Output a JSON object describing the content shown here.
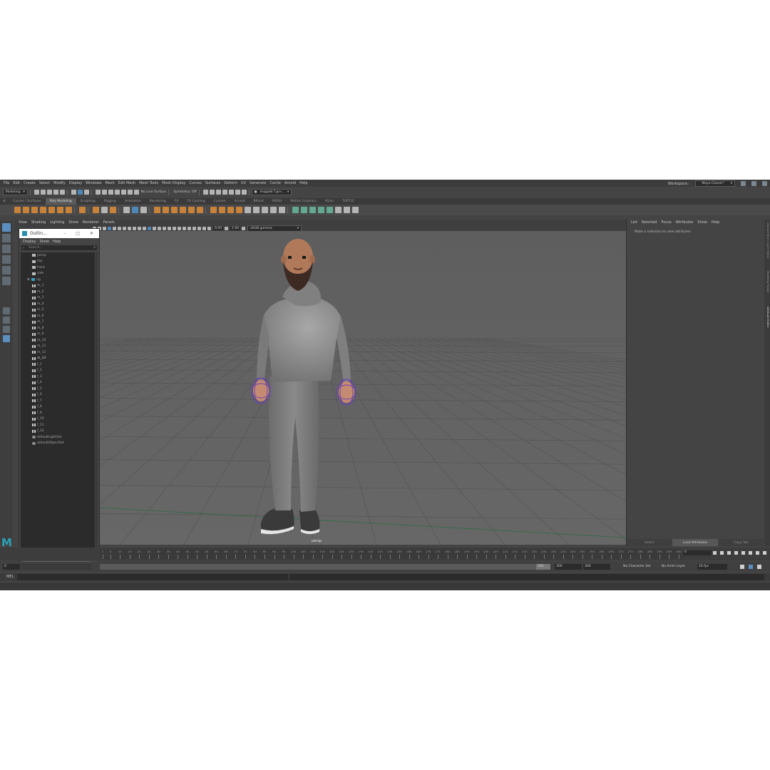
{
  "menubar": {
    "items": [
      "File",
      "Edit",
      "Create",
      "Select",
      "Modify",
      "Display",
      "Windows",
      "Mesh",
      "Edit Mesh",
      "Mesh Tools",
      "Mesh Display",
      "Curves",
      "Surfaces",
      "Deform",
      "UV",
      "Generate",
      "Cache",
      "Arnold",
      "Help"
    ],
    "workspace_label": "Workspace :",
    "workspace_value": "Maya Classic*"
  },
  "statusline": {
    "mode": "Modeling",
    "live_surface": "No Live Surface",
    "symmetry": "Symmetry: Off",
    "user": "Андрей Гурч..."
  },
  "shelf": {
    "tabs": [
      "Curves / Surfaces",
      "Poly Modeling",
      "Sculpting",
      "Rigging",
      "Animation",
      "Rendering",
      "FX",
      "FX Caching",
      "Custom",
      "Arnold",
      "Bifrost",
      "MASH",
      "Motion Graphics",
      "XGen",
      "TURTLE"
    ],
    "active_tab": "Poly Modeling"
  },
  "panel": {
    "menu": [
      "View",
      "Shading",
      "Lighting",
      "Show",
      "Renderer",
      "Panels"
    ],
    "field1": "0.00",
    "field2": "1.00",
    "colorspace": "sRGB gamma",
    "camera_label": "persp"
  },
  "outliner": {
    "title": "Outlin...",
    "menu": [
      "Display",
      "Show",
      "Help"
    ],
    "search_placeholder": "Search...",
    "items": [
      {
        "label": "persp",
        "type": "cam"
      },
      {
        "label": "top",
        "type": "cam"
      },
      {
        "label": "front",
        "type": "cam"
      },
      {
        "label": "side",
        "type": "cam"
      },
      {
        "label": "rig",
        "type": "group"
      },
      {
        "label": "m_1",
        "type": "joint"
      },
      {
        "label": "m_2",
        "type": "joint"
      },
      {
        "label": "m_3",
        "type": "joint"
      },
      {
        "label": "m_4",
        "type": "joint"
      },
      {
        "label": "m_5",
        "type": "joint"
      },
      {
        "label": "m_6",
        "type": "joint"
      },
      {
        "label": "m_7",
        "type": "joint"
      },
      {
        "label": "m_8",
        "type": "joint"
      },
      {
        "label": "m_9",
        "type": "joint"
      },
      {
        "label": "m_10",
        "type": "joint"
      },
      {
        "label": "m_11",
        "type": "joint"
      },
      {
        "label": "m_12",
        "type": "joint"
      },
      {
        "label": "m_13",
        "type": "joint"
      },
      {
        "label": "f_1",
        "type": "joint"
      },
      {
        "label": "f_2",
        "type": "joint"
      },
      {
        "label": "f_3",
        "type": "joint"
      },
      {
        "label": "f_4",
        "type": "joint"
      },
      {
        "label": "f_5",
        "type": "joint"
      },
      {
        "label": "f_6",
        "type": "joint"
      },
      {
        "label": "f_7",
        "type": "joint"
      },
      {
        "label": "f_8",
        "type": "joint"
      },
      {
        "label": "f_9",
        "type": "joint"
      },
      {
        "label": "f_10",
        "type": "joint"
      },
      {
        "label": "f_11",
        "type": "joint"
      },
      {
        "label": "f_12",
        "type": "joint"
      },
      {
        "label": "defaultLightSet",
        "type": "set"
      },
      {
        "label": "defaultObjectSet",
        "type": "set"
      }
    ]
  },
  "attribute_editor": {
    "menu": [
      "List",
      "Selected",
      "Focus",
      "Attributes",
      "Show",
      "Help"
    ],
    "message": "Make a selection to view attributes",
    "buttons": [
      "Select",
      "Load Attributes",
      "Copy Tab"
    ],
    "side_tabs": [
      "Channel Box / Layer Editor",
      "Modeling Toolkit",
      "Attribute Editor"
    ]
  },
  "timeline": {
    "ticks": [
      1,
      5,
      10,
      15,
      20,
      25,
      30,
      35,
      40,
      45,
      50,
      55,
      60,
      65,
      70,
      75,
      80,
      85,
      90,
      95,
      100,
      105,
      110,
      115,
      120,
      125,
      130,
      135,
      140,
      145,
      150,
      155,
      160,
      165,
      170,
      175,
      180,
      185,
      190,
      195,
      200,
      205,
      210,
      215,
      220,
      225,
      230,
      235,
      240,
      245,
      250,
      255,
      260,
      265,
      270,
      275,
      280,
      285,
      290,
      295,
      300
    ],
    "start": 1,
    "end": 300,
    "current_frame": "0"
  },
  "range": {
    "start": "0",
    "inner_end": "300",
    "end": "300",
    "max": "300",
    "character_set": "No Character Set",
    "anim_layer": "No Anim Layer",
    "fps": "24 fps"
  },
  "mel": {
    "label": "MEL"
  },
  "colors": {
    "ui_bg": "#444444",
    "viewport_bg": "#616161",
    "accent_blue": "#5a8fbf",
    "shelf_orange": "#c9823a"
  }
}
